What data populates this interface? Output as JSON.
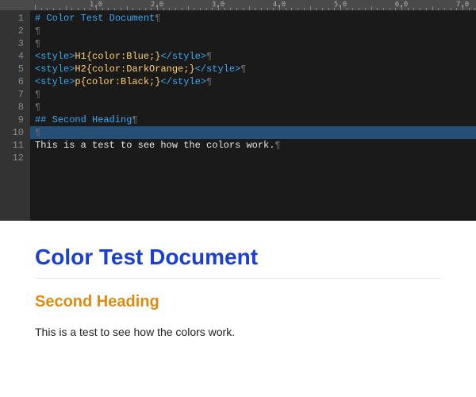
{
  "ruler": {
    "labels": [
      "1,0",
      "2,0",
      "3,0",
      "4,0",
      "5,0",
      "6,0",
      "7,0"
    ]
  },
  "editor": {
    "line_count": 12,
    "pilcrow": "¶",
    "lines": {
      "l1_md": "# Color Test Document",
      "l4_tag_open": "<style>",
      "l4_sel": "H1",
      "l4_rule": "{color:Blue;}",
      "l4_tag_close": "</style>",
      "l5_tag_open": "<style>",
      "l5_sel": "H2",
      "l5_rule": "{color:DarkOrange;}",
      "l5_tag_close": "</style>",
      "l6_tag_open": "<style>",
      "l6_sel": "p",
      "l6_rule": "{color:Black;}",
      "l6_tag_close": "</style>",
      "l9_md": "## Second Heading",
      "l11_text": "This is a test to see how the colors work."
    }
  },
  "preview": {
    "h1": "Color Test Document",
    "h2": "Second Heading",
    "p": "This is a test to see how the colors work."
  }
}
